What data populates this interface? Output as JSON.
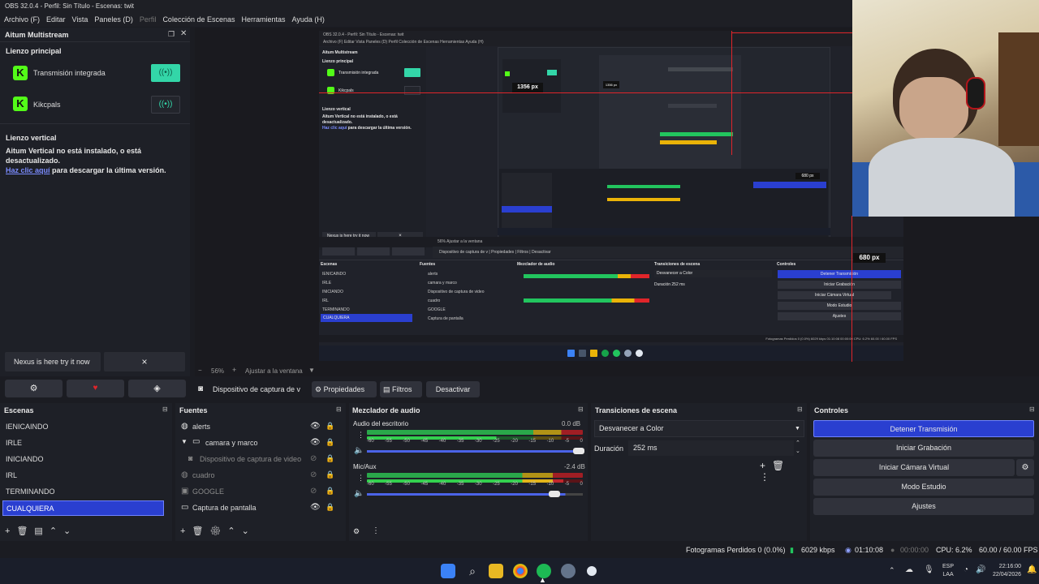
{
  "window": {
    "title": "OBS 32.0.4 - Perfil: Sin Título - Escenas: twit"
  },
  "menu": [
    {
      "label": "Archivo (F)"
    },
    {
      "label": "Editar"
    },
    {
      "label": "Vista"
    },
    {
      "label": "Paneles (D)"
    },
    {
      "label": "Perfil",
      "dim": true
    },
    {
      "label": "Colección de Escenas"
    },
    {
      "label": "Herramientas"
    },
    {
      "label": "Ayuda (H)"
    }
  ],
  "multistream": {
    "title": "Aitum Multistream",
    "main_canvas_title": "Lienzo principal",
    "outputs": [
      {
        "label": "Transmisión integrada",
        "active": true
      },
      {
        "label": "Kikcpals",
        "active": false
      }
    ],
    "vertical_title": "Lienzo vertical",
    "vertical_warning": "Aitum Vertical no está instalado, o está desactualizado.",
    "click_here": "Haz clic aquí",
    "download_text": " para descargar la última versión.",
    "nexus_text": "Nexus is here try it now",
    "nexus_close": "×"
  },
  "preview": {
    "zoom": "56%",
    "fit_label": "Ajustar a la ventana",
    "measure_1": "680 px",
    "nested_measure": "1356 px",
    "nested_measure2": "680 px"
  },
  "source_toolbar": {
    "source_name": "Dispositivo de captura de v",
    "properties": "Propiedades",
    "filters": "Filtros",
    "deactivate": "Desactivar"
  },
  "scenes": {
    "title": "Escenas",
    "items": [
      "IENICAINDO",
      "IRLE",
      "INICIANDO",
      "IRL",
      "TERMINANDO",
      "CUALQUIERA"
    ],
    "selected": "CUALQUIERA"
  },
  "sources": {
    "title": "Fuentes",
    "items": [
      {
        "label": "alerts",
        "icon": "browser-icon",
        "visible": true
      },
      {
        "label": "camara y marco",
        "icon": "folder-icon",
        "visible": true
      },
      {
        "label": "Dispositivo de captura de video",
        "icon": "camera-icon",
        "visible": false
      },
      {
        "label": "cuadro",
        "icon": "browser-icon",
        "visible": false
      },
      {
        "label": "GOOGLE",
        "icon": "window-icon",
        "visible": false
      },
      {
        "label": "Captura de pantalla",
        "icon": "monitor-icon",
        "visible": true
      }
    ]
  },
  "mixer": {
    "title": "Mezclador de audio",
    "channels": [
      {
        "label": "Audio del escritorio",
        "db": "0.0 dB",
        "level": 0.82
      },
      {
        "label": "Mic/Aux",
        "db": "-2.4 dB",
        "level": 0.9
      }
    ],
    "ticks": [
      "-60",
      "-55",
      "-50",
      "-45",
      "-40",
      "-35",
      "-30",
      "-25",
      "-20",
      "-15",
      "-10",
      "-5",
      "0"
    ]
  },
  "transitions": {
    "title": "Transiciones de escena",
    "selected": "Desvanecer a Color",
    "duration_label": "Duración",
    "duration_value": "252 ms"
  },
  "controls": {
    "title": "Controles",
    "stop_stream": "Detener Transmisión",
    "start_recording": "Iniciar Grabación",
    "start_virtual_cam": "Iniciar Cámara Virtual",
    "studio_mode": "Modo Estudio",
    "settings": "Ajustes"
  },
  "status": {
    "dropped": "Fotogramas Perdidos 0 (0.0%)",
    "bitrate": "6029 kbps",
    "stream_time": "01:10:08",
    "rec_time": "00:00:00",
    "cpu": "CPU: 6.2%",
    "fps": "60.00 / 60.00 FPS"
  },
  "taskbar": {
    "lang1": "ESP",
    "lang2": "LAA",
    "time": "22:16:00",
    "date": "22/04/2026"
  },
  "colors": {
    "accent": "#2a3fd0",
    "live": "#33d6a8",
    "kick": "#53fc18",
    "record": "#e0252a"
  }
}
